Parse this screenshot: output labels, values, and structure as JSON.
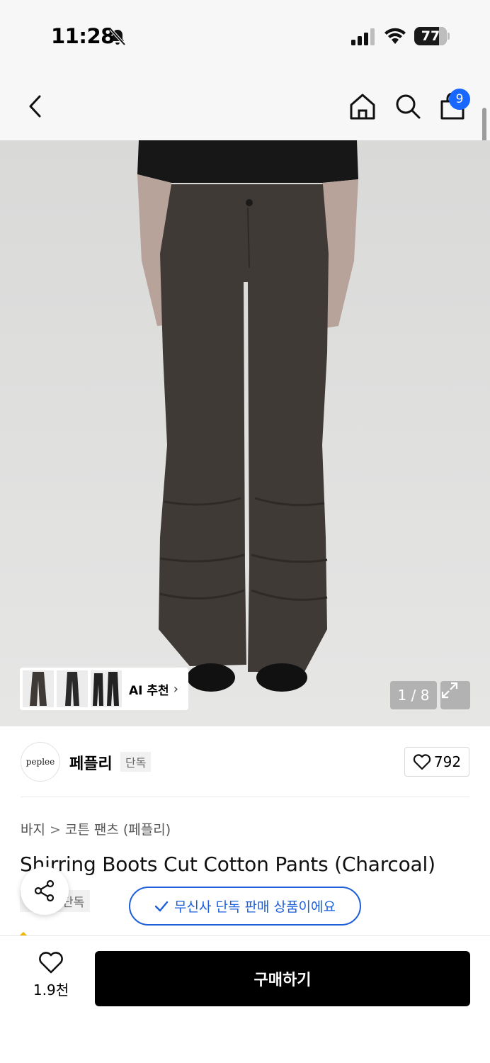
{
  "status_bar": {
    "time": "11:28",
    "battery_level": "77",
    "battery_fraction": 0.77
  },
  "nav": {
    "cart_count": "9"
  },
  "gallery": {
    "ai_label": "AI 추천",
    "ai_chevron": "›",
    "page_counter": "1 / 8"
  },
  "brand": {
    "logo_text": "peplee",
    "name": "페플리",
    "tag": "단독"
  },
  "likes": {
    "count": "792"
  },
  "breadcrumb": {
    "category": "바지",
    "separator": ">",
    "subcategory": "코튼 팬츠 (페플리)"
  },
  "product": {
    "title": "Shirring Boots Cut Cotton Pants (Charcoal)",
    "exclusive_tag": "단독"
  },
  "toast": {
    "message": "무신사 단독 판매 상품이에요"
  },
  "bottom_bar": {
    "wish_count": "1.9천",
    "buy_label": "구매하기"
  },
  "icons": {
    "status": [
      "bell-slash-icon",
      "cellular-signal-icon",
      "wifi-icon",
      "battery-icon"
    ],
    "nav": [
      "chevron-left-icon",
      "home-icon",
      "search-icon",
      "shopping-bag-icon"
    ],
    "gallery": [
      "expand-icon"
    ],
    "actions": [
      "heart-icon",
      "share-icon",
      "check-icon"
    ]
  },
  "colors": {
    "accent_blue": "#1867ff",
    "toast_blue": "#1c5fd9",
    "buy_button": "#000000",
    "pants": "#3f3a36",
    "backdrop": "#dcdcdb"
  }
}
